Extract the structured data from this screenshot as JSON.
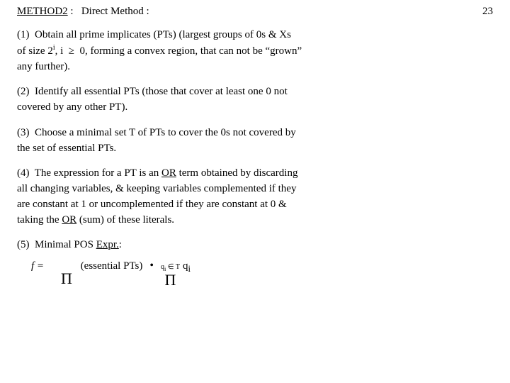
{
  "header": {
    "method_underline": "METHOD2",
    "colon1": " : ",
    "method_name": "Direct Method",
    "colon2": " :",
    "page_number": "23"
  },
  "steps": [
    {
      "number": "(1)",
      "text_lines": [
        "Obtain all prime implicates (PTs) (largest groups of 0s & Xs",
        "of size 2ⁱ, i ≥ 0, forming a convex region, that can not be “grown”",
        "any further)."
      ]
    },
    {
      "number": "(2)",
      "text_lines": [
        "Identify all essential PTs (those that cover at least one 0 not",
        "covered by any other PT)."
      ]
    },
    {
      "number": "(3)",
      "text_lines": [
        "Choose a minimal set T of PTs to cover the 0s not covered by",
        "the set of essential PTs."
      ]
    },
    {
      "number": "(4)",
      "text_lines": [
        "The expression for a PT is an OR term obtained by discarding",
        "all changing variables, & keeping variables complemented if they",
        "are constant at 1 or uncomplemented if they are constant at 0 &",
        "taking the OR (sum) of these literals."
      ],
      "underline_words": [
        "OR",
        "OR"
      ]
    },
    {
      "number": "(5)",
      "text_lines": [
        "Minimal POS Expr.:"
      ],
      "formula": {
        "f": "f =",
        "pi_symbol": "Π",
        "essential": "(essential PTs)",
        "bullet": "•",
        "product_sub_top": "qᵢ ∈ T",
        "q_i": "qᵢ"
      }
    }
  ]
}
